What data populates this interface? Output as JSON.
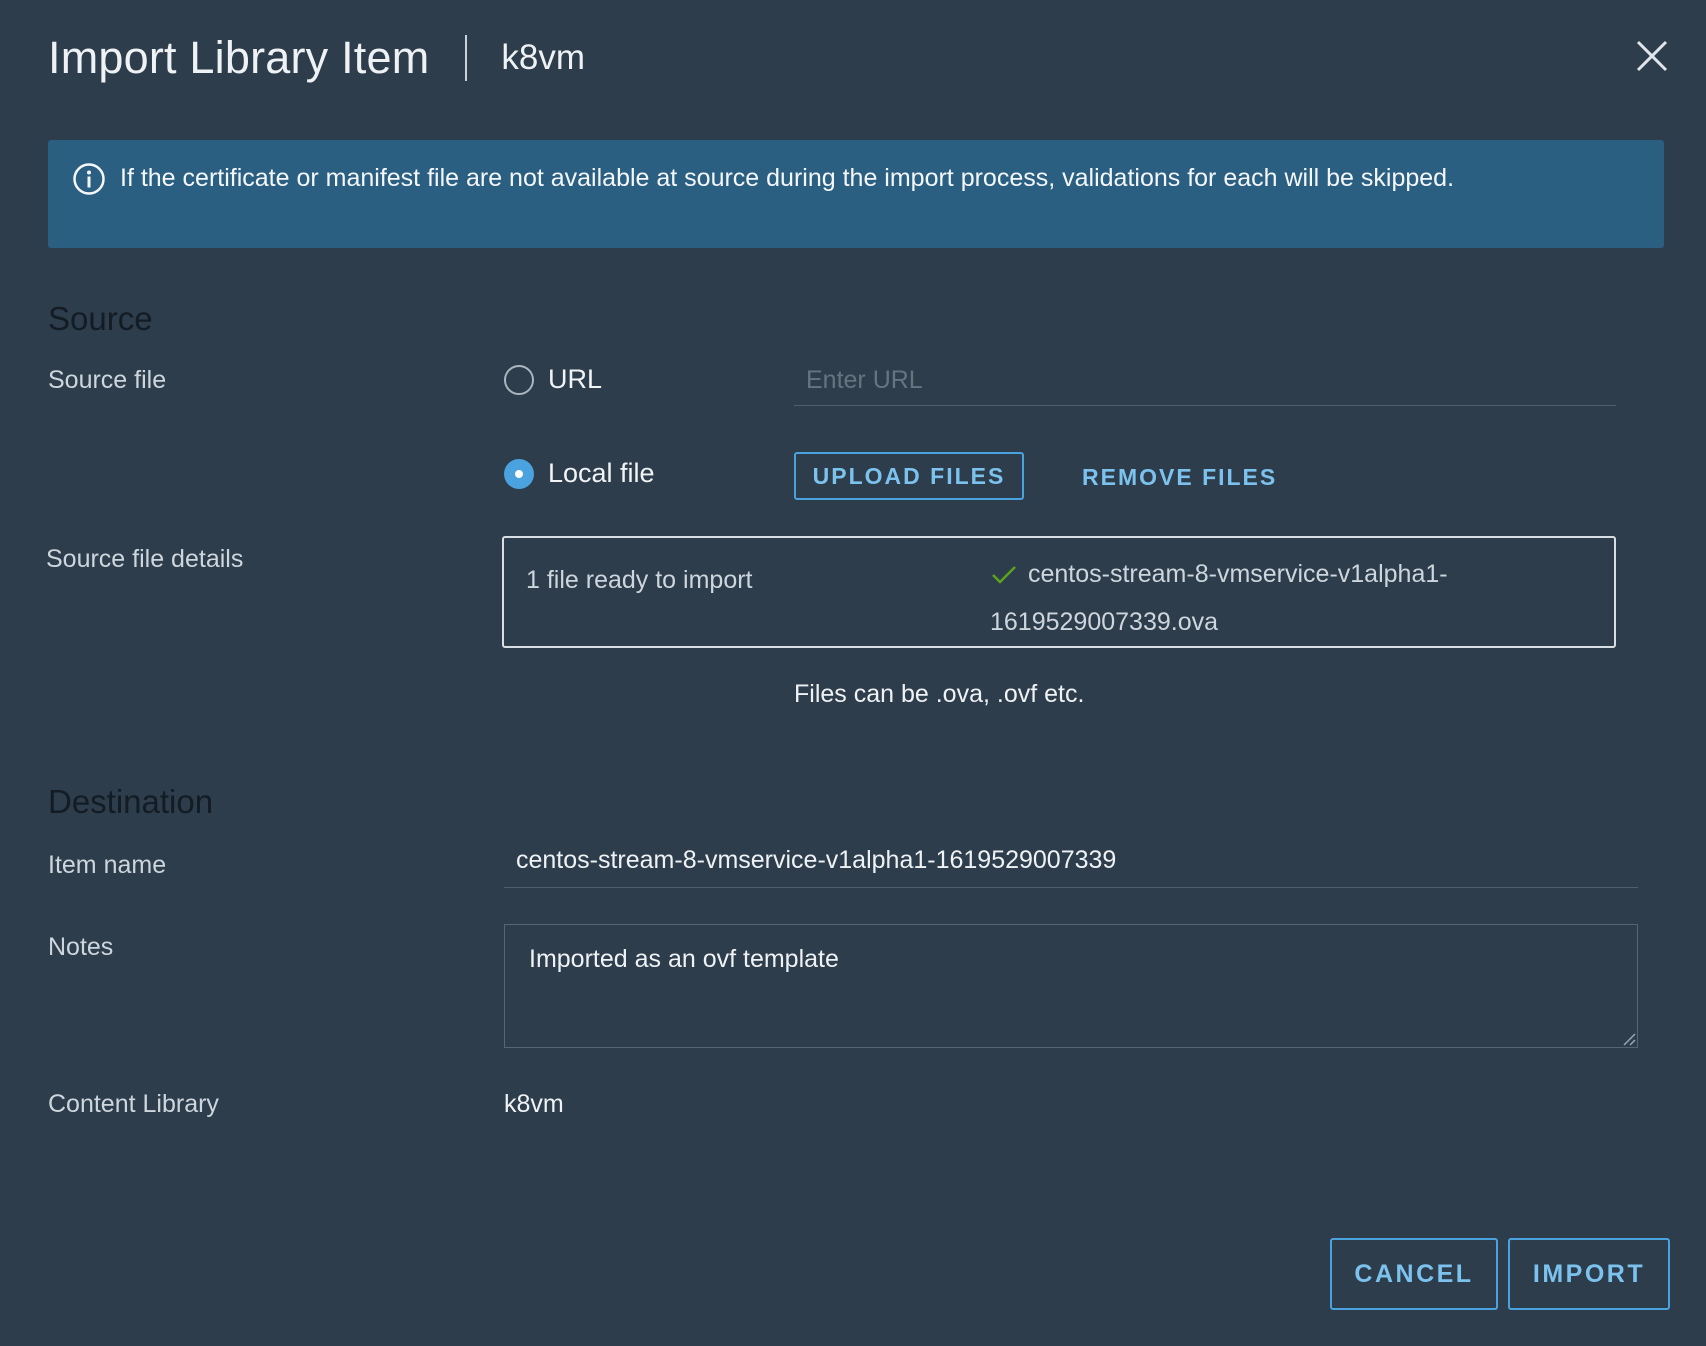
{
  "header": {
    "title": "Import Library Item",
    "subtitle": "k8vm"
  },
  "alert": {
    "icon": "info-circle-icon",
    "text": "If the certificate or manifest file are not available at source during the import process, validations for each will be skipped."
  },
  "source": {
    "section_title": "Source",
    "source_file_label": "Source file",
    "url_option_label": "URL",
    "url_selected": false,
    "url_placeholder": "Enter URL",
    "local_option_label": "Local file",
    "local_selected": true,
    "upload_button_label": "UPLOAD FILES",
    "remove_button_label": "REMOVE FILES",
    "details_label": "Source file details",
    "file_count_text": "1 file ready to import",
    "file_name": "centos-stream-8-vmservice-v1alpha1-1619529007339.ova",
    "hint": "Files can be .ova, .ovf etc."
  },
  "destination": {
    "section_title": "Destination",
    "item_name_label": "Item name",
    "item_name_value": "centos-stream-8-vmservice-v1alpha1-1619529007339",
    "notes_label": "Notes",
    "notes_value": "Imported as an ovf template",
    "content_library_label": "Content Library",
    "content_library_value": "k8vm"
  },
  "footer": {
    "cancel_label": "CANCEL",
    "import_label": "IMPORT"
  },
  "colors": {
    "background": "#2e3d4b",
    "alert_background": "#2b5f82",
    "accent": "#4aa3df",
    "success": "#5aa220"
  }
}
